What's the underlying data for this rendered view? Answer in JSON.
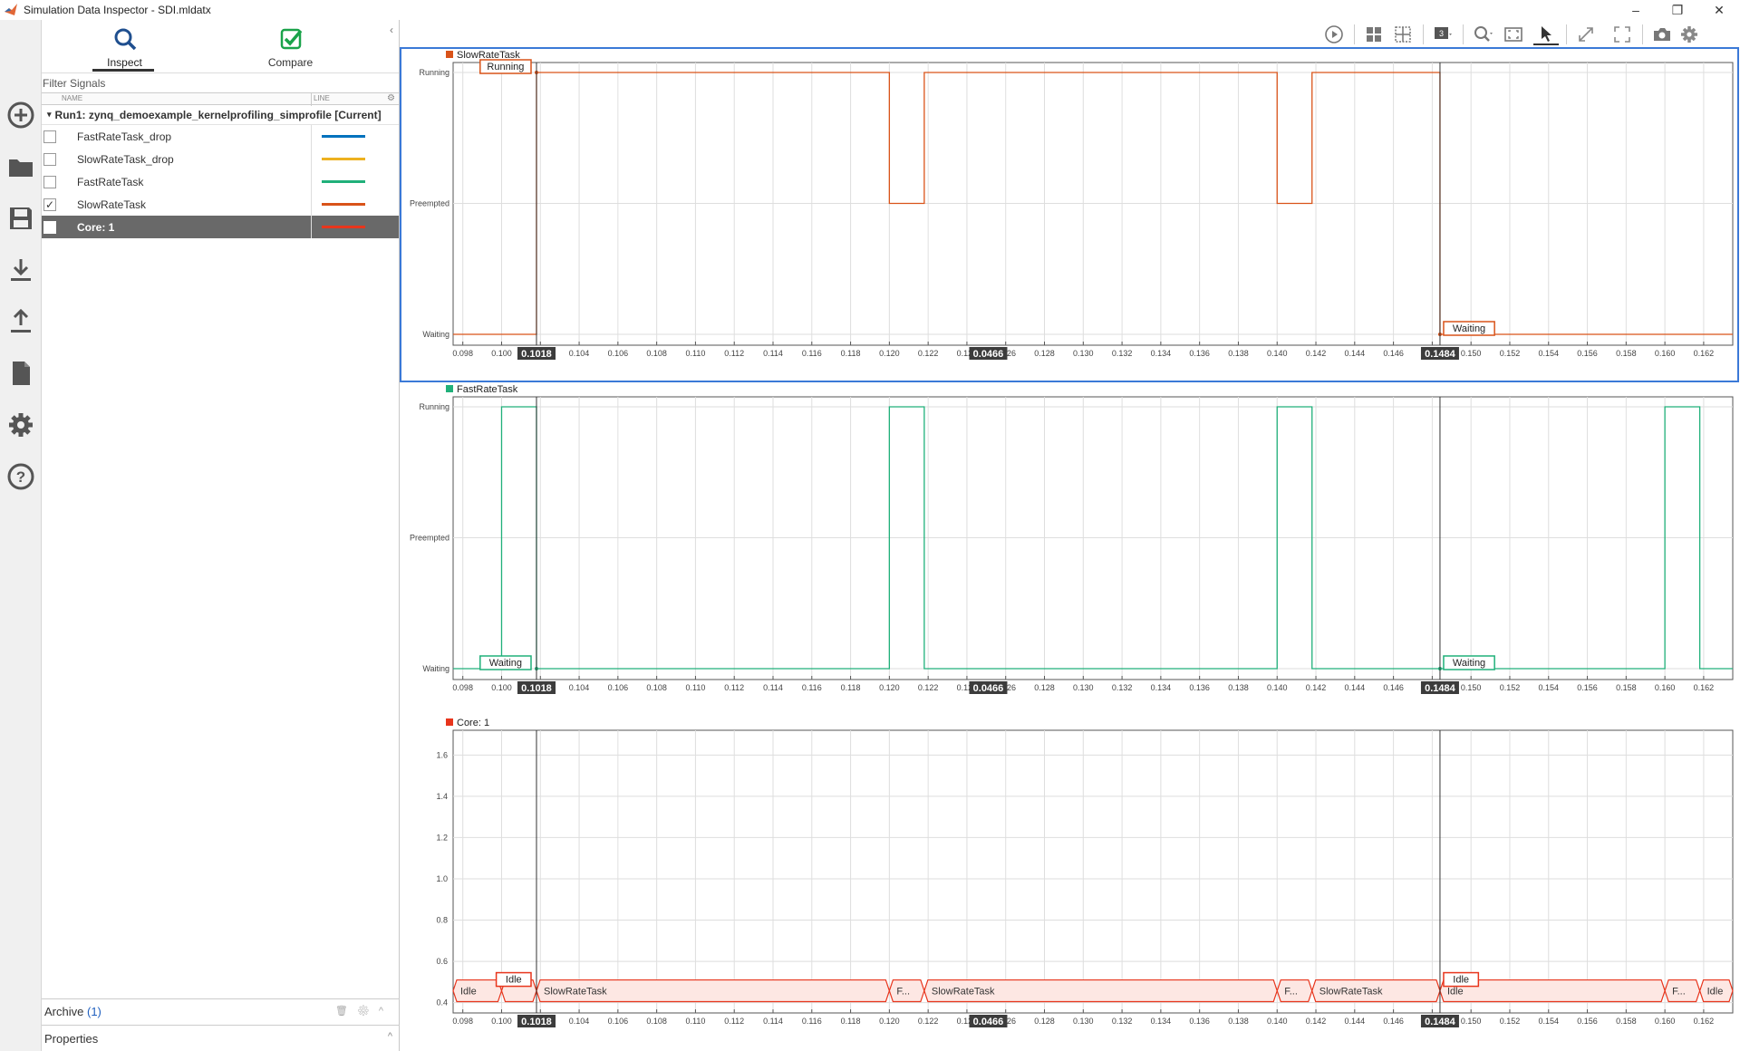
{
  "window": {
    "title": "Simulation Data Inspector - SDI.mldatx",
    "controls": [
      "–",
      "❐",
      "✕"
    ]
  },
  "left_toolbar": {
    "items": [
      {
        "icon": "add-circle-icon"
      },
      {
        "icon": "folder-icon"
      },
      {
        "icon": "save-icon"
      },
      {
        "icon": "download-icon"
      },
      {
        "icon": "upload-icon"
      },
      {
        "icon": "document-icon"
      },
      {
        "icon": "gear-icon"
      },
      {
        "icon": "help-icon"
      }
    ]
  },
  "sidebar": {
    "tabs": [
      {
        "label": "Inspect",
        "icon": "search-icon",
        "active": true
      },
      {
        "label": "Compare",
        "icon": "checkmark-icon",
        "active": false
      }
    ],
    "filter_placeholder": "Filter Signals",
    "columns": {
      "name": "NAME",
      "line": "LINE"
    },
    "run": "Run1: zynq_demoexample_kernelprofiling_simprofile [Current]",
    "signals": [
      {
        "name": "FastRateTask_drop",
        "checked": false,
        "color": "#0072bd",
        "selected": false
      },
      {
        "name": "SlowRateTask_drop",
        "checked": false,
        "color": "#edb120",
        "selected": false
      },
      {
        "name": "FastRateTask",
        "checked": false,
        "color": "#20b07a",
        "selected": false
      },
      {
        "name": "SlowRateTask",
        "checked": true,
        "color": "#d95319",
        "selected": false
      },
      {
        "name": "Core: 1",
        "checked": false,
        "color": "#e8351c",
        "selected": true
      }
    ],
    "archive_label": "Archive",
    "archive_count": "(1)",
    "properties_label": "Properties"
  },
  "plot_toolbar": {
    "icons": [
      "play-icon",
      "layout-grid-icon",
      "layout-subplot-icon",
      "subplot-count-icon",
      "zoom-icon",
      "fit-to-view-icon",
      "cursor-icon",
      "expand-icon",
      "fullscreen-icon",
      "camera-icon",
      "settings-icon"
    ]
  },
  "cursors": {
    "left": "0.1018",
    "right": "0.1484",
    "delta": "0.0466"
  },
  "chart_data": [
    {
      "type": "line",
      "title": "SlowRateTask",
      "color": "#d95319",
      "yticks": [
        "Running",
        "Preempted",
        "Waiting"
      ],
      "xlim": [
        0.0975,
        0.1635
      ],
      "xticks": [
        "0.098",
        "0.100",
        "0.102",
        "0.104",
        "0.106",
        "0.108",
        "0.110",
        "0.112",
        "0.114",
        "0.116",
        "0.118",
        "0.120",
        "0.122",
        "0.124",
        "0.126",
        "0.128",
        "0.130",
        "0.132",
        "0.134",
        "0.136",
        "0.138",
        "0.140",
        "0.142",
        "0.144",
        "0.146",
        "0.148",
        "0.150",
        "0.152",
        "0.154",
        "0.156",
        "0.158",
        "0.160",
        "0.162"
      ],
      "steps": [
        [
          0.0975,
          0
        ],
        [
          0.1018,
          2
        ],
        [
          0.12,
          1
        ],
        [
          0.1218,
          2
        ],
        [
          0.14,
          1
        ],
        [
          0.1418,
          2
        ],
        [
          0.1484,
          0
        ],
        [
          0.1635,
          0
        ]
      ],
      "labels": [
        {
          "text": "Running",
          "x": 0.1018
        },
        {
          "text": "Waiting",
          "x": 0.1484
        }
      ]
    },
    {
      "type": "line",
      "title": "FastRateTask",
      "color": "#20b07a",
      "yticks": [
        "Running",
        "Preempted",
        "Waiting"
      ],
      "xlim": [
        0.0975,
        0.1635
      ],
      "xticks": [
        "0.098",
        "0.100",
        "0.102",
        "0.104",
        "0.106",
        "0.108",
        "0.110",
        "0.112",
        "0.114",
        "0.116",
        "0.118",
        "0.120",
        "0.122",
        "0.124",
        "0.126",
        "0.128",
        "0.130",
        "0.132",
        "0.134",
        "0.136",
        "0.138",
        "0.140",
        "0.142",
        "0.144",
        "0.146",
        "0.148",
        "0.150",
        "0.152",
        "0.154",
        "0.156",
        "0.158",
        "0.160",
        "0.162"
      ],
      "steps": [
        [
          0.0975,
          0
        ],
        [
          0.1,
          2
        ],
        [
          0.1018,
          0
        ],
        [
          0.12,
          2
        ],
        [
          0.1218,
          0
        ],
        [
          0.14,
          2
        ],
        [
          0.1418,
          0
        ],
        [
          0.16,
          2
        ],
        [
          0.1618,
          0
        ],
        [
          0.1635,
          0
        ]
      ],
      "labels": [
        {
          "text": "Waiting",
          "x": 0.1018
        },
        {
          "text": "Waiting",
          "x": 0.1484
        }
      ]
    },
    {
      "type": "table",
      "title": "Core: 1",
      "color": "#e8351c",
      "yticks": [
        "0.4",
        "0.6",
        "0.8",
        "1.0",
        "1.2",
        "1.4",
        "1.6"
      ],
      "xlim": [
        0.0975,
        0.1635
      ],
      "xticks": [
        "0.098",
        "0.100",
        "0.102",
        "0.104",
        "0.106",
        "0.108",
        "0.110",
        "0.112",
        "0.114",
        "0.116",
        "0.118",
        "0.120",
        "0.122",
        "0.124",
        "0.126",
        "0.128",
        "0.130",
        "0.132",
        "0.134",
        "0.136",
        "0.138",
        "0.140",
        "0.142",
        "0.144",
        "0.146",
        "0.148",
        "0.150",
        "0.152",
        "0.154",
        "0.156",
        "0.158",
        "0.160",
        "0.162"
      ],
      "segments": [
        {
          "from": 0.0975,
          "to": 0.1,
          "label": "Idle"
        },
        {
          "from": 0.1,
          "to": 0.1018,
          "label": "..."
        },
        {
          "from": 0.1018,
          "to": 0.12,
          "label": "SlowRateTask"
        },
        {
          "from": 0.12,
          "to": 0.1218,
          "label": "F..."
        },
        {
          "from": 0.1218,
          "to": 0.14,
          "label": "SlowRateTask"
        },
        {
          "from": 0.14,
          "to": 0.1418,
          "label": "F..."
        },
        {
          "from": 0.1418,
          "to": 0.1484,
          "label": "SlowRateTask"
        },
        {
          "from": 0.1484,
          "to": 0.16,
          "label": "Idle"
        },
        {
          "from": 0.16,
          "to": 0.1618,
          "label": "F..."
        },
        {
          "from": 0.1618,
          "to": 0.1635,
          "label": "Idle"
        }
      ],
      "labels": [
        {
          "text": "Idle",
          "x": 0.1018
        },
        {
          "text": "Idle",
          "x": 0.1484
        }
      ]
    }
  ]
}
